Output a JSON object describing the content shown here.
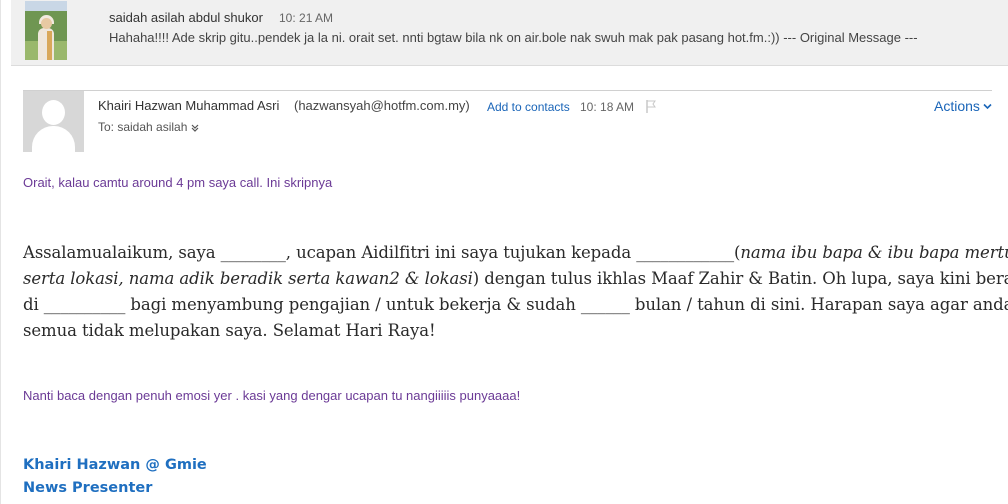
{
  "previous_message": {
    "sender": "saidah asilah abdul shukor",
    "time": "10: 21 AM",
    "preview": "Hahaha!!!! Ade skrip gitu..pendek ja la ni. orait set. nnti bgtaw bila nk on air.bole nak swuh mak pak pasang hot.fm.:)) --- Original Message ---"
  },
  "message": {
    "sender_name": "Khairi Hazwan Muhammad Asri",
    "sender_email": "(hazwansyah@hotfm.com.my)",
    "add_to_contacts": "Add to contacts",
    "time": "10: 18 AM",
    "to": "To: saidah asilah",
    "actions_label": "Actions"
  },
  "body": {
    "intro": "Orait, kalau camtu around 4 pm saya call. Ini skripnya",
    "script": {
      "l1a": "Assalamualaikum, saya ________, ucapan Aidilfitri ini saya tujukan kepada ____________(",
      "l1b": "nama ibu bapa & ibu bapa mertua",
      "l2a": "serta lokasi, nama adik beradik serta kawan2 & lokasi",
      "l2b": ") dengan tulus ikhlas Maaf Zahir & Batin. Oh lupa, saya kini berada",
      "l3": "di __________ bagi menyambung pengajian / untuk bekerja & sudah ______ bulan / tahun di sini. Harapan saya agar anda",
      "l4": "semua tidak melupakan saya. Selamat Hari Raya!"
    },
    "closing": "Nanti baca dengan penuh emosi yer . kasi yang dengar ucapan tu nangiiiiis punyaaaa!"
  },
  "signature": {
    "name": "Khairi Hazwan @ Gmie",
    "title": "News Presenter"
  },
  "colors": {
    "link": "#1a65b8",
    "intro_text": "#6b3a96",
    "signature": "#1f6fc0",
    "collapsed_bg": "#f0f0f0"
  },
  "icons": [
    "flag-icon",
    "chevron-down-icon",
    "default-avatar-icon"
  ]
}
